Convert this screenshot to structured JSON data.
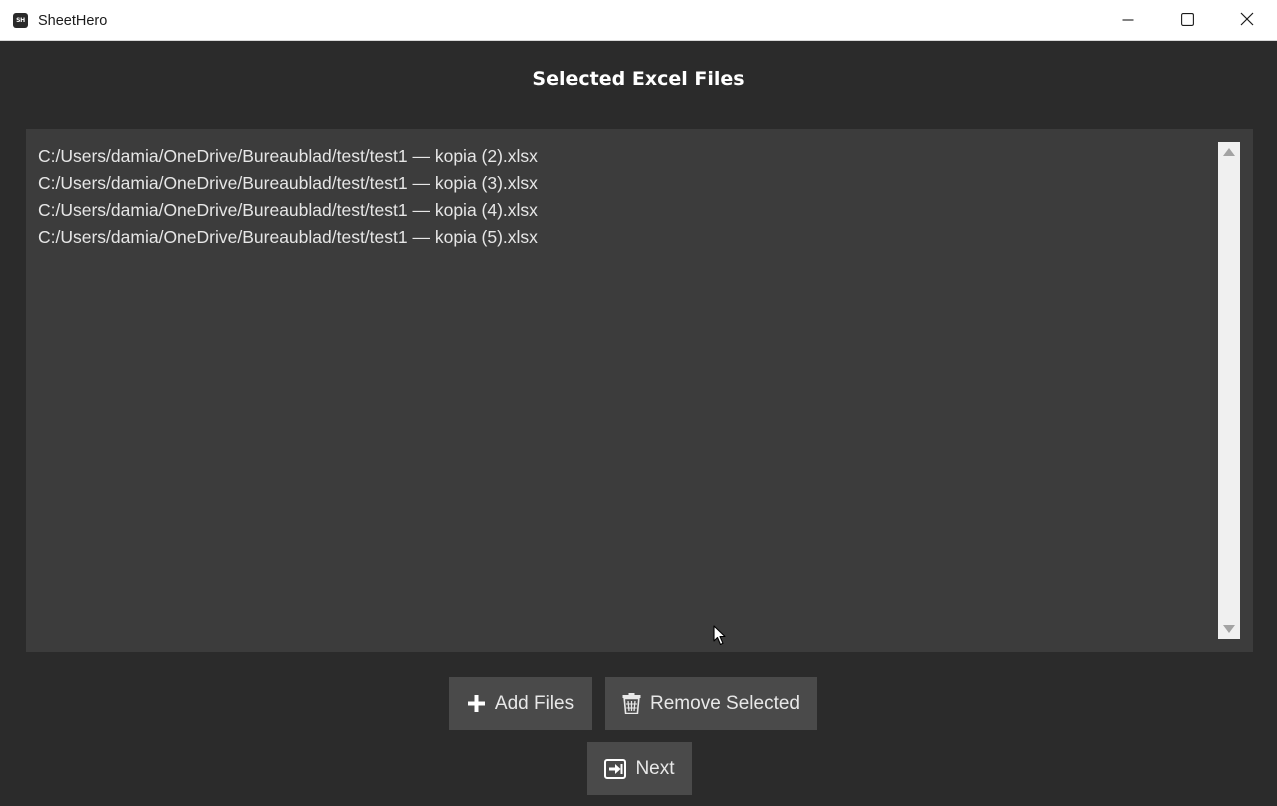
{
  "window": {
    "app_icon_text": "SH",
    "title": "SheetHero"
  },
  "heading": "Selected Excel Files",
  "files": [
    "C:/Users/damia/OneDrive/Bureaublad/test/test1 — kopia (2).xlsx",
    "C:/Users/damia/OneDrive/Bureaublad/test/test1 — kopia (3).xlsx",
    "C:/Users/damia/OneDrive/Bureaublad/test/test1 — kopia (4).xlsx",
    "C:/Users/damia/OneDrive/Bureaublad/test/test1 — kopia (5).xlsx"
  ],
  "buttons": {
    "add_label": "Add Files",
    "add_icon": "plus-icon",
    "remove_label": "Remove Selected",
    "remove_icon": "trash-icon",
    "next_label": "Next",
    "next_icon": "arrow-right-box-icon"
  },
  "colors": {
    "background": "#2b2b2b",
    "list_background": "#3c3c3c",
    "button_background": "#4a4a4a",
    "text": "#ffffff"
  }
}
